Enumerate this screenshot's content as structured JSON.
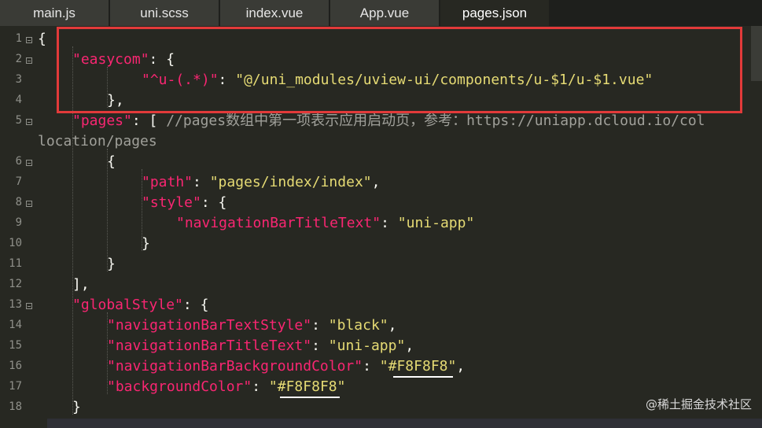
{
  "tabs": [
    {
      "label": "main.js"
    },
    {
      "label": "uni.scss"
    },
    {
      "label": "index.vue"
    },
    {
      "label": "App.vue"
    },
    {
      "label": "pages.json",
      "active": true
    }
  ],
  "editor": {
    "line_numbers": [
      "1",
      "2",
      "3",
      "4",
      "5",
      "",
      "6",
      "7",
      "8",
      "9",
      "10",
      "11",
      "12",
      "13",
      "14",
      "15",
      "16",
      "17",
      "18"
    ],
    "lines": {
      "l1": {
        "brace": "{"
      },
      "l2": {
        "key": "\"easycom\"",
        "rest": ": {"
      },
      "l3": {
        "key": "\"^u-(.*)\"",
        "colon": ": ",
        "value": "\"@/uni_modules/uview-ui/components/u-$1/u-$1.vue\""
      },
      "l4": {
        "text": "},"
      },
      "l5": {
        "key": "\"pages\"",
        "rest": ": [ ",
        "comment": "//pages数组中第一项表示应用启动页，参考：https://uniapp.dcloud.io/col"
      },
      "l5b": {
        "comment": "location/pages"
      },
      "l6": {
        "text": "{"
      },
      "l7": {
        "key": "\"path\"",
        "colon": ": ",
        "value": "\"pages/index/index\"",
        "tail": ","
      },
      "l8": {
        "key": "\"style\"",
        "rest": ": {"
      },
      "l9": {
        "key": "\"navigationBarTitleText\"",
        "colon": ": ",
        "value": "\"uni-app\""
      },
      "l10": {
        "text": "}"
      },
      "l11": {
        "text": "}"
      },
      "l12": {
        "text": "],"
      },
      "l13": {
        "key": "\"globalStyle\"",
        "rest": ": {"
      },
      "l14": {
        "key": "\"navigationBarTextStyle\"",
        "colon": ": ",
        "value": "\"black\"",
        "tail": ","
      },
      "l15": {
        "key": "\"navigationBarTitleText\"",
        "colon": ": ",
        "value": "\"uni-app\"",
        "tail": ","
      },
      "l16": {
        "key": "\"navigationBarBackgroundColor\"",
        "colon": ": ",
        "value": "\"#F8F8F8\"",
        "tail": ","
      },
      "l17": {
        "key": "\"backgroundColor\"",
        "colon": ": ",
        "value": "\"#F8F8F8\""
      },
      "l18": {
        "text": "}"
      }
    }
  },
  "watermark": "@稀土掘金技术社区",
  "colors": {
    "background": "#272822",
    "key": "#f92672",
    "string": "#e6db74",
    "highlight_box": "#e23a3a"
  }
}
